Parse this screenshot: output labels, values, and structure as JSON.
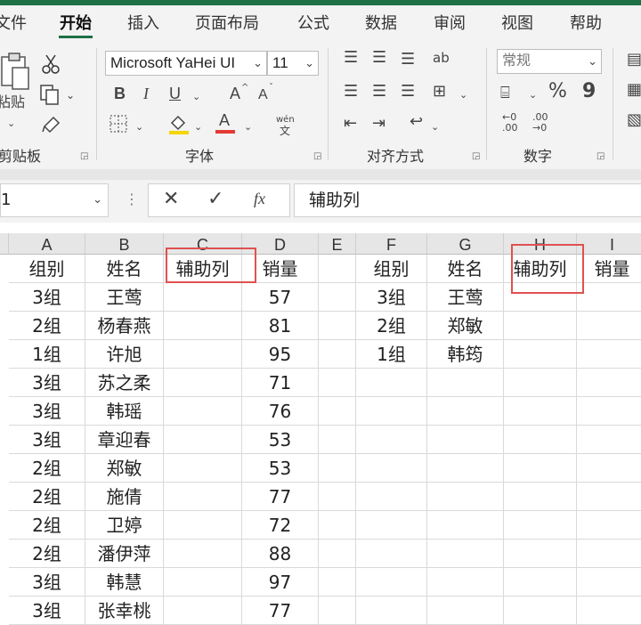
{
  "tabs": [
    "文件",
    "开始",
    "插入",
    "页面布局",
    "公式",
    "数据",
    "审阅",
    "视图",
    "帮助"
  ],
  "active_tab": "开始",
  "ribbon": {
    "clipboard": {
      "label": "剪贴板",
      "paste_label": "粘贴"
    },
    "font": {
      "label": "字体",
      "font_name": "Microsoft YaHei UI",
      "font_size": "11",
      "bold": "B",
      "italic": "I",
      "underline": "U",
      "grow": "A",
      "shrink": "A",
      "font_color_glyph": "A",
      "font_color": "#e53935",
      "wen_label": "wén",
      "wen_char": "文"
    },
    "alignment": {
      "label": "对齐方式"
    },
    "number": {
      "label": "数字",
      "format": "常规",
      "percent": "%",
      "comma": "9"
    }
  },
  "formula_bar": {
    "name_box": "1",
    "content": "辅助列",
    "fx": "fx"
  },
  "columns": [
    "A",
    "B",
    "C",
    "D",
    "E",
    "F",
    "G",
    "H",
    "I"
  ],
  "left_table": {
    "headers": [
      "组别",
      "姓名",
      "辅助列",
      "销量"
    ],
    "rows": [
      [
        "3组",
        "王莺",
        "",
        "57"
      ],
      [
        "2组",
        "杨春燕",
        "",
        "81"
      ],
      [
        "1组",
        "许旭",
        "",
        "95"
      ],
      [
        "3组",
        "苏之柔",
        "",
        "71"
      ],
      [
        "3组",
        "韩瑶",
        "",
        "76"
      ],
      [
        "3组",
        "章迎春",
        "",
        "53"
      ],
      [
        "2组",
        "郑敏",
        "",
        "53"
      ],
      [
        "2组",
        "施倩",
        "",
        "77"
      ],
      [
        "2组",
        "卫婷",
        "",
        "72"
      ],
      [
        "2组",
        "潘伊萍",
        "",
        "88"
      ],
      [
        "3组",
        "韩慧",
        "",
        "97"
      ],
      [
        "3组",
        "张幸桃",
        "",
        "77"
      ]
    ]
  },
  "right_table": {
    "headers": [
      "组别",
      "姓名",
      "辅助列",
      "销量"
    ],
    "rows": [
      [
        "3组",
        "王莺",
        "",
        ""
      ],
      [
        "2组",
        "郑敏",
        "",
        ""
      ],
      [
        "1组",
        "韩筠",
        "",
        ""
      ]
    ]
  },
  "highlight_color": "#e05050"
}
